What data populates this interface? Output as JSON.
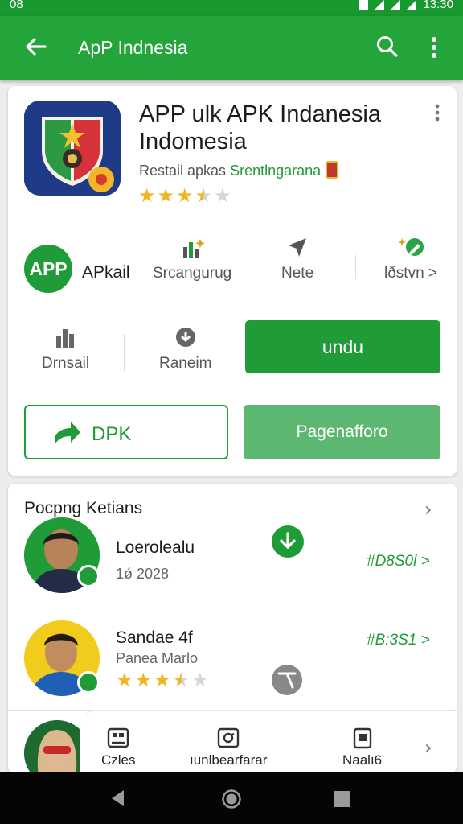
{
  "status_bar": {
    "left": "08",
    "time": "13:30"
  },
  "app_bar": {
    "title": "ApP Indnesia"
  },
  "app": {
    "name": "APP ulk APK Indanesia Indomesia",
    "developer_prefix": "Restail apkas",
    "developer_name": "Srentlngarana",
    "rating_stars": 3.5,
    "circle_label": "APP",
    "label": "APkail"
  },
  "stats": [
    {
      "icon": "sparkle-chart-icon",
      "label": "Srcangurug"
    },
    {
      "icon": "pin-icon",
      "label": "Nete"
    },
    {
      "icon": "pencil-icon",
      "label": "lðstvn >"
    }
  ],
  "actions": {
    "downloads_label": "Drnsail",
    "review_label": "Raneim",
    "install_label": "undu",
    "outline_label": "DPK",
    "secondary_label": "Pagenafforo"
  },
  "section": {
    "title": "Pocpng Ketians",
    "items": [
      {
        "name": "Loerolealu",
        "sub": "1ǿ 2028",
        "code": "#D8S0l >"
      },
      {
        "name": "Sandae 4f",
        "sub": "Panea Marlo",
        "code": "#B:3S1 >",
        "stars": 3.5
      }
    ]
  },
  "bottom_nav": [
    {
      "icon": "image-icon",
      "label": "Czles"
    },
    {
      "icon": "refresh-frame-icon",
      "label": "ıunlbearfarar"
    },
    {
      "icon": "document-icon",
      "label": "Naalı6"
    }
  ],
  "colors": {
    "primary": "#23a53c",
    "accent_dark": "#1f9b37",
    "light_button": "#5cb870",
    "star": "#f1b522"
  }
}
